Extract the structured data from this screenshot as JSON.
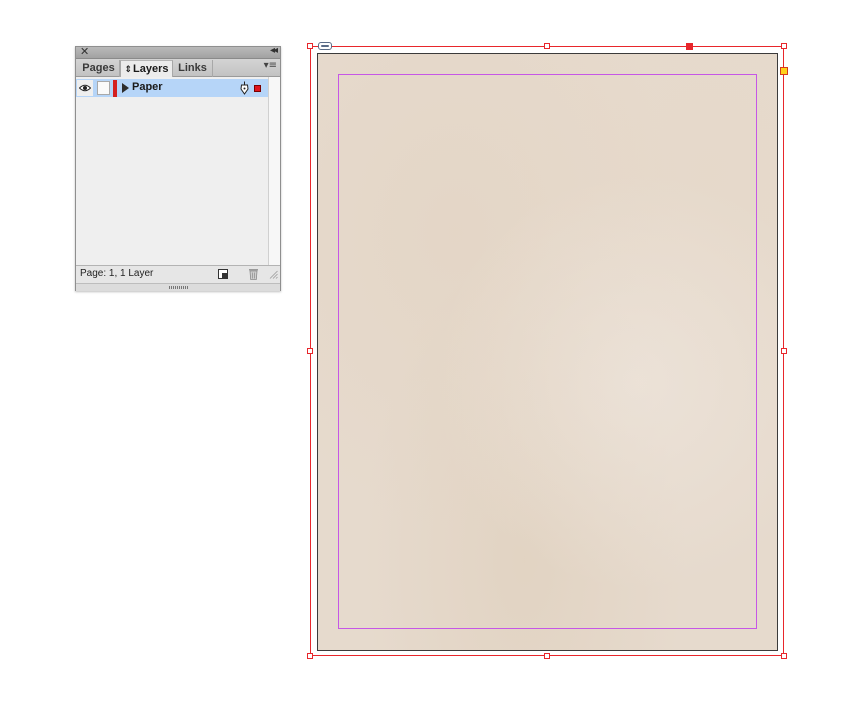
{
  "panel": {
    "close_glyph": "✕",
    "collapse_glyph": "◂◂",
    "menu_glyph": "▾≡",
    "tabs": [
      {
        "label": "Pages",
        "active": false
      },
      {
        "label": "Layers",
        "active": true,
        "prefix_glyph": "⇕"
      },
      {
        "label": "Links",
        "active": false
      }
    ],
    "layers": [
      {
        "name": "Paper",
        "visible": true,
        "locked": false,
        "color": "#d41f1f",
        "selected": true
      }
    ],
    "status": "Page: 1, 1 Layer",
    "icons": {
      "visibility": "eye-icon",
      "expand": "triangle-right-icon",
      "edit": "pen-icon",
      "selection": "selection-square-icon",
      "new_layer": "new-layer-icon",
      "delete": "trash-icon"
    }
  },
  "document": {
    "page_color": "#e6dacd",
    "frame_color": "#e8262b",
    "margin_color": "#c657e6"
  }
}
